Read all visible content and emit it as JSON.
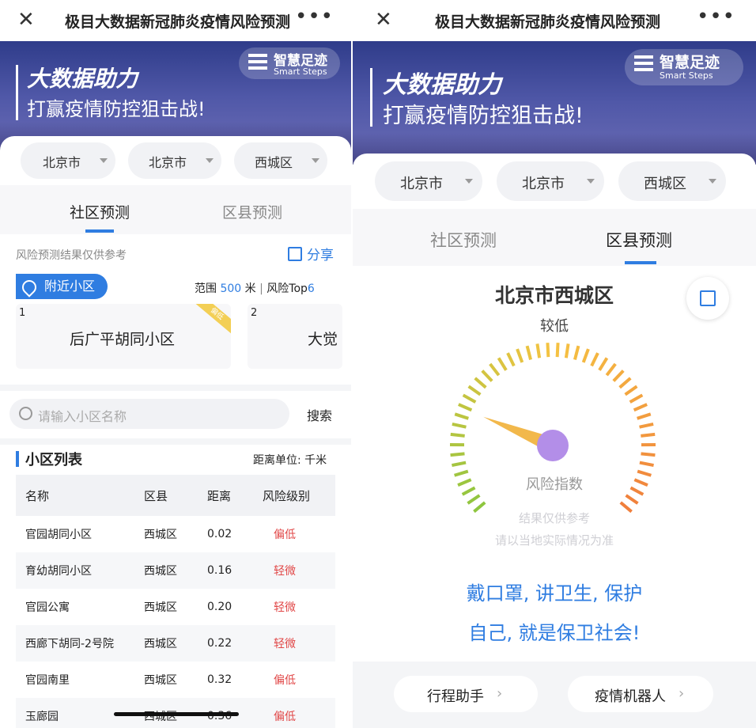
{
  "left": {
    "nav": {
      "title": "极目大数据新冠肺炎疫情风险预测"
    },
    "banner": {
      "line1": "大数据助力",
      "line2": "打赢疫情防控狙击战!"
    },
    "logo": {
      "cn": "智慧足迹",
      "en": "Smart Steps"
    },
    "selectors": [
      "北京市",
      "北京市",
      "西城区"
    ],
    "tabs": [
      "社区预测",
      "区县预测"
    ],
    "active_tab": "社区预测",
    "disclaimer": "风险预测结果仅供参考",
    "share_label": "分享",
    "nearby": {
      "label": "附近小区",
      "range_prefix": "范围",
      "range_value": "500",
      "range_unit": "米",
      "separator": "|",
      "top_label": "风险Top",
      "top_value": "6"
    },
    "nearby_cards": [
      {
        "rank": "1",
        "name": "后广平胡同小区",
        "badge": "偏低"
      },
      {
        "rank": "2",
        "name": "大觉"
      }
    ],
    "search": {
      "placeholder": "请输入小区名称",
      "button": "搜索"
    },
    "list": {
      "title": "小区列表",
      "unit": "距离单位: 千米",
      "columns": [
        "名称",
        "区县",
        "距离",
        "风险级别"
      ],
      "rows": [
        {
          "name": "官园胡同小区",
          "district": "西城区",
          "distance": "0.02",
          "risk": "偏低"
        },
        {
          "name": "育幼胡同小区",
          "district": "西城区",
          "distance": "0.16",
          "risk": "轻微"
        },
        {
          "name": "官园公寓",
          "district": "西城区",
          "distance": "0.20",
          "risk": "轻微"
        },
        {
          "name": "西廊下胡同-2号院",
          "district": "西城区",
          "distance": "0.22",
          "risk": "轻微"
        },
        {
          "name": "官园南里",
          "district": "西城区",
          "distance": "0.32",
          "risk": "偏低"
        },
        {
          "name": "玉廊园",
          "district": "西城区",
          "distance": "0.36",
          "risk": "偏低"
        }
      ]
    }
  },
  "right": {
    "nav": {
      "title": "极目大数据新冠肺炎疫情风险预测"
    },
    "banner": {
      "line1": "大数据助力",
      "line2": "打赢疫情防控狙击战!"
    },
    "logo": {
      "cn": "智慧足迹",
      "en": "Smart Steps"
    },
    "selectors": [
      "北京市",
      "北京市",
      "西城区"
    ],
    "tabs": [
      "社区预测",
      "区县预测"
    ],
    "active_tab": "区县预测",
    "region": "北京市西城区",
    "level": "较低",
    "gauge": {
      "label": "风险指数",
      "needle_fraction": 0.24
    },
    "note1": "结果仅供参考",
    "note2": "请以当地实际情况为准",
    "slogan1": "戴口罩, 讲卫生, 保护",
    "slogan2": "自己, 就是保卫社会!",
    "buttons": [
      "行程助手",
      "疫情机器人"
    ]
  },
  "colors": {
    "accent": "#2f7de1",
    "risk_red": "#e14848",
    "gauge_start": "#8ec63f",
    "gauge_mid": "#f5c342",
    "gauge_end": "#f07f3c",
    "needle": "#f2b84b",
    "hub": "#b38ee8"
  }
}
